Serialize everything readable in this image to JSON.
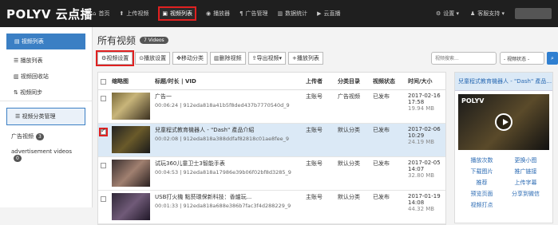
{
  "brand": {
    "logo": "POLYV 云点播"
  },
  "nav": {
    "items": [
      {
        "icon": "home-icon",
        "glyph": "⌂",
        "label": "首页"
      },
      {
        "icon": "upload-icon",
        "glyph": "⬆",
        "label": "上传视频"
      },
      {
        "icon": "video-list-icon",
        "glyph": "▣",
        "label": "视频列表"
      },
      {
        "icon": "player-icon",
        "glyph": "◉",
        "label": "播放器"
      },
      {
        "icon": "ad-icon",
        "glyph": "¶",
        "label": "广告管理"
      },
      {
        "icon": "stats-icon",
        "glyph": "▥",
        "label": "数据统计"
      },
      {
        "icon": "live-icon",
        "glyph": "▶",
        "label": "云直播"
      }
    ],
    "settings": "设置 ▾",
    "support": "客服支持 ▾"
  },
  "sidebar": {
    "video_list": "视频列表",
    "items": [
      "播放列表",
      "视频回收站",
      "视频同步"
    ],
    "category_manage": "视频分类管理",
    "categories": [
      {
        "label": "广告视频",
        "count": "3"
      },
      {
        "label": "advertisement videos",
        "count": "0"
      }
    ]
  },
  "main": {
    "title": "所有视频",
    "count": "7 Videos",
    "toolbar": {
      "video_settings": "视频设置",
      "play_settings": "播放设置",
      "move_category": "移动分类",
      "delete_video": "删除视频",
      "export_video": "导出视频▾",
      "play_list": "播放列表"
    },
    "search_placeholder": "视频搜索...",
    "status_select": "- 视频状态 -",
    "columns": [
      "缩略图",
      "标题/时长 | VID",
      "上传者",
      "分类目录",
      "视频状态",
      "时间/大小"
    ],
    "rows": [
      {
        "title": "广告一",
        "meta": "00:06:24 | 912eda818a41b5f8ded437b7770540d_9",
        "uploader": "主账号",
        "category": "广告视频",
        "status": "已发布",
        "date": "2017-02-16",
        "time": "17:58",
        "size": "19.94 MB",
        "selected": false
      },
      {
        "title": "兒童程式教育機器人 - \"Dash\" 產品介紹",
        "meta": "00:02:08 | 912eda818a388ddfaf82818c01ae8fee_9",
        "uploader": "主账号",
        "category": "默认分类",
        "status": "已发布",
        "date": "2017-02-06",
        "time": "10:29",
        "size": "24.19 MB",
        "selected": true
      },
      {
        "title": "试玩360儿童卫士3智能手表",
        "meta": "00:04:53 | 912eda818a17986e39b06f02bf8d3285_9",
        "uploader": "主账号",
        "category": "默认分类",
        "status": "已发布",
        "date": "2017-02-05",
        "time": "14:07",
        "size": "32.80 MB",
        "selected": false
      },
      {
        "title": "USB打火機 點菸環保新科技：香爐玩...",
        "meta": "00:01:33 | 912eda818a688e386b7fac3f4d288229_9",
        "uploader": "主账号",
        "category": "默认分类",
        "status": "已发布",
        "date": "2017-01-19",
        "time": "14:08",
        "size": "44.32 MB",
        "selected": false
      }
    ]
  },
  "preview": {
    "title": "兒童程式教育機器人 - \"Dash\" 產品...",
    "player_logo": "POLYV",
    "links": [
      "播放次数",
      "更换小图",
      "下载图片",
      "推广链接",
      "推荐",
      "上传字幕",
      "预览页面",
      "分享到微信",
      "视频打点"
    ]
  }
}
